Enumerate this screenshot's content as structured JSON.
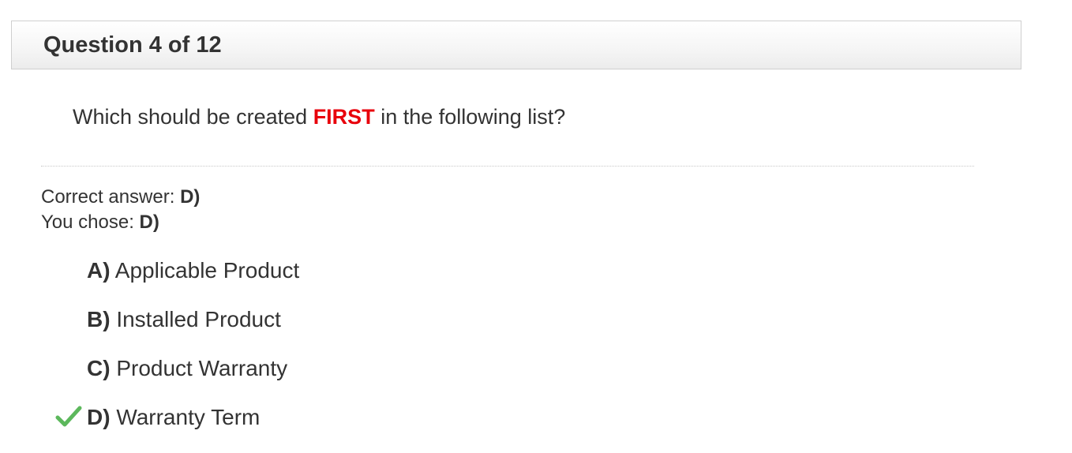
{
  "header": {
    "title": "Question 4 of 12"
  },
  "question": {
    "text_before": "Which should be created ",
    "highlight": "FIRST",
    "text_after": " in the following list?",
    "highlight_color": "#e8000b"
  },
  "result": {
    "correct_label": "Correct answer: ",
    "correct_value": "D)",
    "chosen_label": "You chose: ",
    "chosen_value": "D)"
  },
  "options": [
    {
      "letter": "A)",
      "text": " Applicable Product",
      "selected": false
    },
    {
      "letter": "B)",
      "text": " Installed Product",
      "selected": false
    },
    {
      "letter": "C)",
      "text": " Product Warranty",
      "selected": false
    },
    {
      "letter": "D)",
      "text": " Warranty Term",
      "selected": true
    }
  ],
  "icons": {
    "selected_marker": "checkmark-icon",
    "check_color": "#5cb85c"
  }
}
